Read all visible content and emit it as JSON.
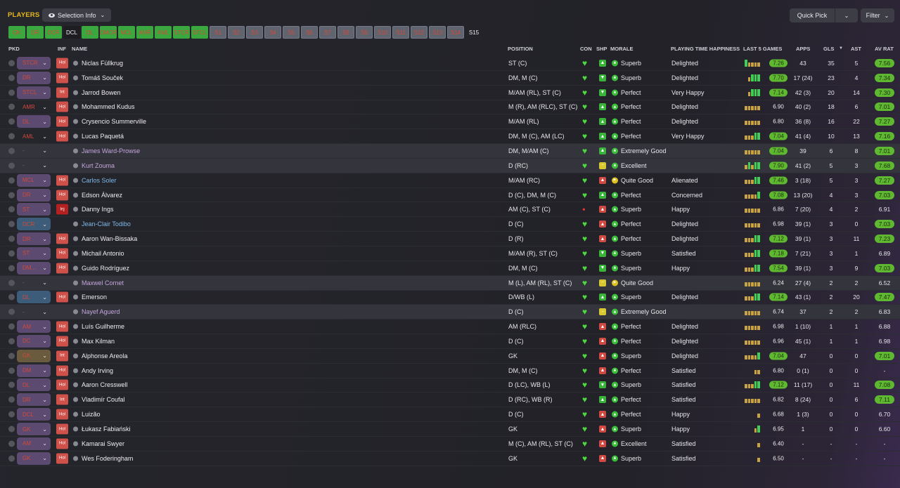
{
  "header": {
    "title": "PLAYERS",
    "selection_label": "Selection Info",
    "quick_pick_label": "Quick Pick",
    "filter_label": "Filter"
  },
  "position_buttons": [
    {
      "label": "GK",
      "state": "filled"
    },
    {
      "label": "DR",
      "state": "filled"
    },
    {
      "label": "DCR",
      "state": "filled"
    },
    {
      "label": "DCL",
      "state": "active"
    },
    {
      "label": "DL",
      "state": "filled"
    },
    {
      "label": "DMCR",
      "state": "filled"
    },
    {
      "label": "MCL",
      "state": "filled"
    },
    {
      "label": "AMR",
      "state": "filled"
    },
    {
      "label": "AML",
      "state": "filled"
    },
    {
      "label": "STCR",
      "state": "filled"
    },
    {
      "label": "STCL",
      "state": "filled"
    },
    {
      "label": "S1",
      "state": "empty"
    },
    {
      "label": "S2",
      "state": "empty"
    },
    {
      "label": "S3",
      "state": "empty"
    },
    {
      "label": "S4",
      "state": "empty"
    },
    {
      "label": "S5",
      "state": "empty"
    },
    {
      "label": "S6",
      "state": "empty"
    },
    {
      "label": "S7",
      "state": "empty"
    },
    {
      "label": "S8",
      "state": "empty"
    },
    {
      "label": "S9",
      "state": "empty"
    },
    {
      "label": "S10",
      "state": "empty"
    },
    {
      "label": "S11",
      "state": "empty"
    },
    {
      "label": "S12",
      "state": "empty"
    },
    {
      "label": "S13",
      "state": "empty"
    },
    {
      "label": "S14",
      "state": "empty"
    },
    {
      "label": "S15",
      "state": "plain"
    }
  ],
  "columns": {
    "pkd": "PKD",
    "inf": "INF",
    "name": "NAME",
    "position": "POSITION",
    "con": "CON",
    "shp": "SHP",
    "morale": "MORALE",
    "pth": "PLAYING TIME HAPPINESS",
    "last5": "LAST 5 GAMES",
    "apps": "APPS",
    "gls": "GLS",
    "ast": "AST",
    "avrat": "AV RAT"
  },
  "colors": {
    "accent": "#e8b81a",
    "good": "#5fb930",
    "bad": "#d0504a"
  },
  "players": [
    {
      "pkd": "STCR",
      "pkd_style": "purple",
      "inf": "Hol",
      "name": "Niclas Füllkrug",
      "name_style": "normal",
      "position": "ST (C)",
      "con": "heart",
      "shp": "up",
      "morale_icon": "up",
      "morale": "Superb",
      "pth": "Delighted",
      "last5": [
        4,
        3,
        3,
        3,
        3
      ],
      "last5_rating": "7.26",
      "last5_hi": true,
      "apps": "43",
      "gls": "35",
      "ast": "5",
      "avr": "7.56",
      "avr_hi": true
    },
    {
      "pkd": "DR",
      "pkd_style": "purple",
      "inf": "Hol",
      "name": "Tomáš Souček",
      "name_style": "normal",
      "position": "DM, M (C)",
      "con": "heart",
      "shp": "down",
      "morale_icon": "up",
      "morale": "Superb",
      "pth": "Delighted",
      "last5": [
        2,
        3,
        4,
        4,
        4
      ],
      "last5_rating": "7.70",
      "last5_hi": true,
      "apps": "17 (24)",
      "gls": "23",
      "ast": "4",
      "avr": "7.34",
      "avr_hi": true
    },
    {
      "pkd": "STCL",
      "pkd_style": "purple",
      "inf": "Int",
      "name": "Jarrod Bowen",
      "name_style": "normal",
      "position": "M/AM (RL), ST (C)",
      "con": "heart",
      "shp": "down",
      "morale_icon": "up",
      "morale": "Perfect",
      "pth": "Very Happy",
      "last5": [
        2,
        3,
        4,
        4,
        4
      ],
      "last5_rating": "7.14",
      "last5_hi": true,
      "apps": "42 (3)",
      "gls": "20",
      "ast": "14",
      "avr": "7.30",
      "avr_hi": true
    },
    {
      "pkd": "AMR",
      "pkd_style": "none-red",
      "inf": "Hol",
      "name": "Mohammed Kudus",
      "name_style": "normal",
      "position": "M (R), AM (RLC), ST (C)",
      "con": "heart",
      "shp": "up",
      "morale_icon": "up",
      "morale": "Perfect",
      "pth": "Delighted",
      "last5": [
        3,
        3,
        3,
        3,
        3
      ],
      "last5_rating": "6.90",
      "last5_hi": false,
      "apps": "40 (2)",
      "gls": "18",
      "ast": "6",
      "avr": "7.01",
      "avr_hi": true
    },
    {
      "pkd": "DL",
      "pkd_style": "purple",
      "inf": "Hol",
      "name": "Crysencio Summerville",
      "name_style": "normal",
      "position": "M/AM (RL)",
      "con": "heart",
      "shp": "up",
      "morale_icon": "up",
      "morale": "Perfect",
      "pth": "Delighted",
      "last5": [
        3,
        3,
        3,
        3,
        3
      ],
      "last5_rating": "6.80",
      "last5_hi": false,
      "apps": "36 (8)",
      "gls": "16",
      "ast": "22",
      "avr": "7.27",
      "avr_hi": true
    },
    {
      "pkd": "AML",
      "pkd_style": "none-red",
      "inf": "Hol",
      "name": "Lucas Paquetá",
      "name_style": "normal",
      "position": "DM, M (C), AM (LC)",
      "con": "heart",
      "shp": "up",
      "morale_icon": "up",
      "morale": "Perfect",
      "pth": "Very Happy",
      "last5": [
        3,
        3,
        3,
        4,
        4
      ],
      "last5_rating": "7.04",
      "last5_hi": true,
      "apps": "41 (4)",
      "gls": "10",
      "ast": "13",
      "avr": "7.16",
      "avr_hi": true
    },
    {
      "pkd": "-",
      "pkd_style": "none",
      "inf": "",
      "name": "James Ward-Prowse",
      "name_style": "loan",
      "position": "DM, M/AM (C)",
      "con": "heart",
      "shp": "up",
      "morale_icon": "up",
      "morale": "Extremely Good",
      "pth": "",
      "last5": [
        3,
        3,
        3,
        3,
        3
      ],
      "last5_rating": "7.04",
      "last5_hi": true,
      "apps": "39",
      "gls": "6",
      "ast": "8",
      "avr": "7.01",
      "avr_hi": true
    },
    {
      "pkd": "-",
      "pkd_style": "none",
      "inf": "",
      "name": "Kurt Zouma",
      "name_style": "loan",
      "position": "D (RC)",
      "con": "heart",
      "shp": "flat",
      "morale_icon": "up",
      "morale": "Excellent",
      "pth": "",
      "last5": [
        3,
        4,
        3,
        4,
        4
      ],
      "last5_rating": "7.90",
      "last5_hi": true,
      "apps": "41 (2)",
      "gls": "5",
      "ast": "3",
      "avr": "7.68",
      "avr_hi": true
    },
    {
      "pkd": "MCL",
      "pkd_style": "purple",
      "inf": "Hol",
      "name": "Carlos Soler",
      "name_style": "blue",
      "position": "M/AM (RC)",
      "con": "heart",
      "shp": "red",
      "morale_icon": "right",
      "morale": "Quite Good",
      "pth": "Alienated",
      "last5": [
        3,
        3,
        3,
        4,
        4
      ],
      "last5_rating": "7.46",
      "last5_hi": true,
      "apps": "3 (18)",
      "gls": "5",
      "ast": "3",
      "avr": "7.27",
      "avr_hi": true
    },
    {
      "pkd": "DR",
      "pkd_style": "purple",
      "inf": "Hol",
      "name": "Edson Álvarez",
      "name_style": "normal",
      "position": "D (C), DM, M (C)",
      "con": "heart",
      "shp": "up",
      "morale_icon": "up",
      "morale": "Perfect",
      "pth": "Concerned",
      "last5": [
        3,
        3,
        3,
        3,
        4
      ],
      "last5_rating": "7.08",
      "last5_hi": true,
      "apps": "13 (20)",
      "gls": "4",
      "ast": "3",
      "avr": "7.03",
      "avr_hi": true
    },
    {
      "pkd": "ST",
      "pkd_style": "purple",
      "inf": "Inj",
      "name": "Danny Ings",
      "name_style": "normal",
      "position": "AM (C), ST (C)",
      "con": "injury",
      "shp": "red",
      "morale_icon": "up",
      "morale": "Superb",
      "pth": "Happy",
      "last5": [
        3,
        3,
        3,
        3,
        3
      ],
      "last5_rating": "6.86",
      "last5_hi": false,
      "apps": "7 (20)",
      "gls": "4",
      "ast": "2",
      "avr": "6.91",
      "avr_hi": false
    },
    {
      "pkd": "DCR",
      "pkd_style": "blue",
      "inf": "",
      "name": "Jean-Clair Todibo",
      "name_style": "blue",
      "position": "D (C)",
      "con": "heart",
      "shp": "red",
      "morale_icon": "up",
      "morale": "Perfect",
      "pth": "Delighted",
      "last5": [
        3,
        3,
        3,
        3,
        3
      ],
      "last5_rating": "6.98",
      "last5_hi": false,
      "apps": "39 (1)",
      "gls": "3",
      "ast": "0",
      "avr": "7.03",
      "avr_hi": true
    },
    {
      "pkd": "DR",
      "pkd_style": "purple",
      "inf": "Hol",
      "name": "Aaron Wan-Bissaka",
      "name_style": "normal",
      "position": "D (R)",
      "con": "heart",
      "shp": "red",
      "morale_icon": "up",
      "morale": "Perfect",
      "pth": "Delighted",
      "last5": [
        3,
        3,
        3,
        4,
        4
      ],
      "last5_rating": "7.12",
      "last5_hi": true,
      "apps": "39 (1)",
      "gls": "3",
      "ast": "11",
      "avr": "7.23",
      "avr_hi": true
    },
    {
      "pkd": "ST",
      "pkd_style": "purple",
      "inf": "Hol",
      "name": "Michail Antonio",
      "name_style": "normal",
      "position": "M/AM (R), ST (C)",
      "con": "heart",
      "shp": "down",
      "morale_icon": "up",
      "morale": "Superb",
      "pth": "Satisfied",
      "last5": [
        3,
        3,
        3,
        4,
        4
      ],
      "last5_rating": "7.18",
      "last5_hi": true,
      "apps": "7 (21)",
      "gls": "3",
      "ast": "1",
      "avr": "6.89",
      "avr_hi": false
    },
    {
      "pkd": "DM...",
      "pkd_style": "purple",
      "inf": "Hol",
      "name": "Guido Rodríguez",
      "name_style": "normal",
      "position": "DM, M (C)",
      "con": "heart",
      "shp": "down",
      "morale_icon": "up",
      "morale": "Superb",
      "pth": "Happy",
      "last5": [
        3,
        3,
        3,
        4,
        4
      ],
      "last5_rating": "7.54",
      "last5_hi": true,
      "apps": "39 (1)",
      "gls": "3",
      "ast": "9",
      "avr": "7.03",
      "avr_hi": true
    },
    {
      "pkd": "-",
      "pkd_style": "none",
      "inf": "",
      "name": "Maxwel Cornet",
      "name_style": "loan",
      "position": "M (L), AM (RL), ST (C)",
      "con": "heart",
      "shp": "flat",
      "morale_icon": "right",
      "morale": "Quite Good",
      "pth": "",
      "last5": [
        3,
        3,
        3,
        3,
        3
      ],
      "last5_rating": "6.24",
      "last5_hi": false,
      "apps": "27 (4)",
      "gls": "2",
      "ast": "2",
      "avr": "6.52",
      "avr_hi": false
    },
    {
      "pkd": "DL",
      "pkd_style": "blue",
      "inf": "Hol",
      "name": "Emerson",
      "name_style": "normal",
      "position": "D/WB (L)",
      "con": "heart",
      "shp": "up",
      "morale_icon": "up",
      "morale": "Superb",
      "pth": "Delighted",
      "last5": [
        3,
        3,
        3,
        4,
        4
      ],
      "last5_rating": "7.14",
      "last5_hi": true,
      "apps": "43 (1)",
      "gls": "2",
      "ast": "20",
      "avr": "7.47",
      "avr_hi": true
    },
    {
      "pkd": "-",
      "pkd_style": "none",
      "inf": "",
      "name": "Nayef Aguerd",
      "name_style": "loan",
      "position": "D (C)",
      "con": "heart",
      "shp": "flat",
      "morale_icon": "up",
      "morale": "Extremely Good",
      "pth": "",
      "last5": [
        3,
        3,
        3,
        3,
        3
      ],
      "last5_rating": "6.74",
      "last5_hi": false,
      "apps": "37",
      "gls": "2",
      "ast": "2",
      "avr": "6.83",
      "avr_hi": false
    },
    {
      "pkd": "AM",
      "pkd_style": "purple",
      "inf": "Hol",
      "name": "Luís Guilherme",
      "name_style": "normal",
      "position": "AM (RLC)",
      "con": "heart",
      "shp": "red",
      "morale_icon": "up",
      "morale": "Perfect",
      "pth": "Delighted",
      "last5": [
        3,
        3,
        3,
        3,
        3
      ],
      "last5_rating": "6.98",
      "last5_hi": false,
      "apps": "1 (10)",
      "gls": "1",
      "ast": "1",
      "avr": "6.88",
      "avr_hi": false
    },
    {
      "pkd": "DC",
      "pkd_style": "purple",
      "inf": "Hol",
      "name": "Max Kilman",
      "name_style": "normal",
      "position": "D (C)",
      "con": "heart",
      "shp": "red",
      "morale_icon": "up",
      "morale": "Perfect",
      "pth": "Delighted",
      "last5": [
        3,
        3,
        3,
        3,
        3
      ],
      "last5_rating": "6.96",
      "last5_hi": false,
      "apps": "45 (1)",
      "gls": "1",
      "ast": "1",
      "avr": "6.98",
      "avr_hi": false
    },
    {
      "pkd": "GK",
      "pkd_style": "orange",
      "inf": "Int",
      "name": "Alphonse Areola",
      "name_style": "normal",
      "position": "GK",
      "con": "heart",
      "shp": "red",
      "morale_icon": "up",
      "morale": "Superb",
      "pth": "Delighted",
      "last5": [
        3,
        3,
        3,
        3,
        4
      ],
      "last5_rating": "7.04",
      "last5_hi": true,
      "apps": "47",
      "gls": "0",
      "ast": "0",
      "avr": "7.01",
      "avr_hi": true
    },
    {
      "pkd": "DM",
      "pkd_style": "purple",
      "inf": "Hol",
      "name": "Andy Irving",
      "name_style": "normal",
      "position": "DM, M (C)",
      "con": "heart",
      "shp": "red",
      "morale_icon": "up",
      "morale": "Perfect",
      "pth": "Satisfied",
      "last5": [
        0,
        0,
        0,
        3,
        3
      ],
      "last5_rating": "6.80",
      "last5_hi": false,
      "apps": "0 (1)",
      "gls": "0",
      "ast": "0",
      "avr": "-",
      "avr_hi": false
    },
    {
      "pkd": "DL",
      "pkd_style": "purple",
      "inf": "Hol",
      "name": "Aaron Cresswell",
      "name_style": "normal",
      "position": "D (LC), WB (L)",
      "con": "heart",
      "shp": "down",
      "morale_icon": "up",
      "morale": "Superb",
      "pth": "Satisfied",
      "last5": [
        3,
        3,
        3,
        4,
        4
      ],
      "last5_rating": "7.12",
      "last5_hi": true,
      "apps": "11 (17)",
      "gls": "0",
      "ast": "11",
      "avr": "7.08",
      "avr_hi": true
    },
    {
      "pkd": "DR",
      "pkd_style": "purple",
      "inf": "Int",
      "name": "Vladimír Coufal",
      "name_style": "normal",
      "position": "D (RC), WB (R)",
      "con": "heart",
      "shp": "up",
      "morale_icon": "up",
      "morale": "Perfect",
      "pth": "Satisfied",
      "last5": [
        3,
        3,
        3,
        3,
        3
      ],
      "last5_rating": "6.82",
      "last5_hi": false,
      "apps": "8 (24)",
      "gls": "0",
      "ast": "6",
      "avr": "7.11",
      "avr_hi": true
    },
    {
      "pkd": "DCL",
      "pkd_style": "purple",
      "inf": "Hol",
      "name": "Luizão",
      "name_style": "normal",
      "position": "D (C)",
      "con": "heart",
      "shp": "red",
      "morale_icon": "up",
      "morale": "Perfect",
      "pth": "Happy",
      "last5": [
        0,
        0,
        0,
        0,
        3
      ],
      "last5_rating": "6.68",
      "last5_hi": false,
      "apps": "1 (3)",
      "gls": "0",
      "ast": "0",
      "avr": "6.70",
      "avr_hi": false
    },
    {
      "pkd": "GK",
      "pkd_style": "purple",
      "inf": "Hol",
      "name": "Łukasz Fabiański",
      "name_style": "normal",
      "position": "GK",
      "con": "heart",
      "shp": "red",
      "morale_icon": "up",
      "morale": "Superb",
      "pth": "Happy",
      "last5": [
        0,
        0,
        0,
        3,
        4
      ],
      "last5_rating": "6.95",
      "last5_hi": false,
      "apps": "1",
      "gls": "0",
      "ast": "0",
      "avr": "6.60",
      "avr_hi": false
    },
    {
      "pkd": "AM",
      "pkd_style": "purple",
      "inf": "Hol",
      "name": "Kamarai Swyer",
      "name_style": "normal",
      "position": "M (C), AM (RL), ST (C)",
      "con": "heart",
      "shp": "red",
      "morale_icon": "up",
      "morale": "Excellent",
      "pth": "Satisfied",
      "last5": [
        0,
        0,
        0,
        0,
        3
      ],
      "last5_rating": "6.40",
      "last5_hi": false,
      "apps": "-",
      "gls": "-",
      "ast": "-",
      "avr": "-",
      "avr_hi": false
    },
    {
      "pkd": "GK",
      "pkd_style": "purple",
      "inf": "Hol",
      "name": "Wes Foderingham",
      "name_style": "normal",
      "position": "GK",
      "con": "heart",
      "shp": "red",
      "morale_icon": "up",
      "morale": "Superb",
      "pth": "Satisfied",
      "last5": [
        0,
        0,
        0,
        0,
        3
      ],
      "last5_rating": "6.50",
      "last5_hi": false,
      "apps": "-",
      "gls": "-",
      "ast": "-",
      "avr": "-",
      "avr_hi": false
    }
  ]
}
